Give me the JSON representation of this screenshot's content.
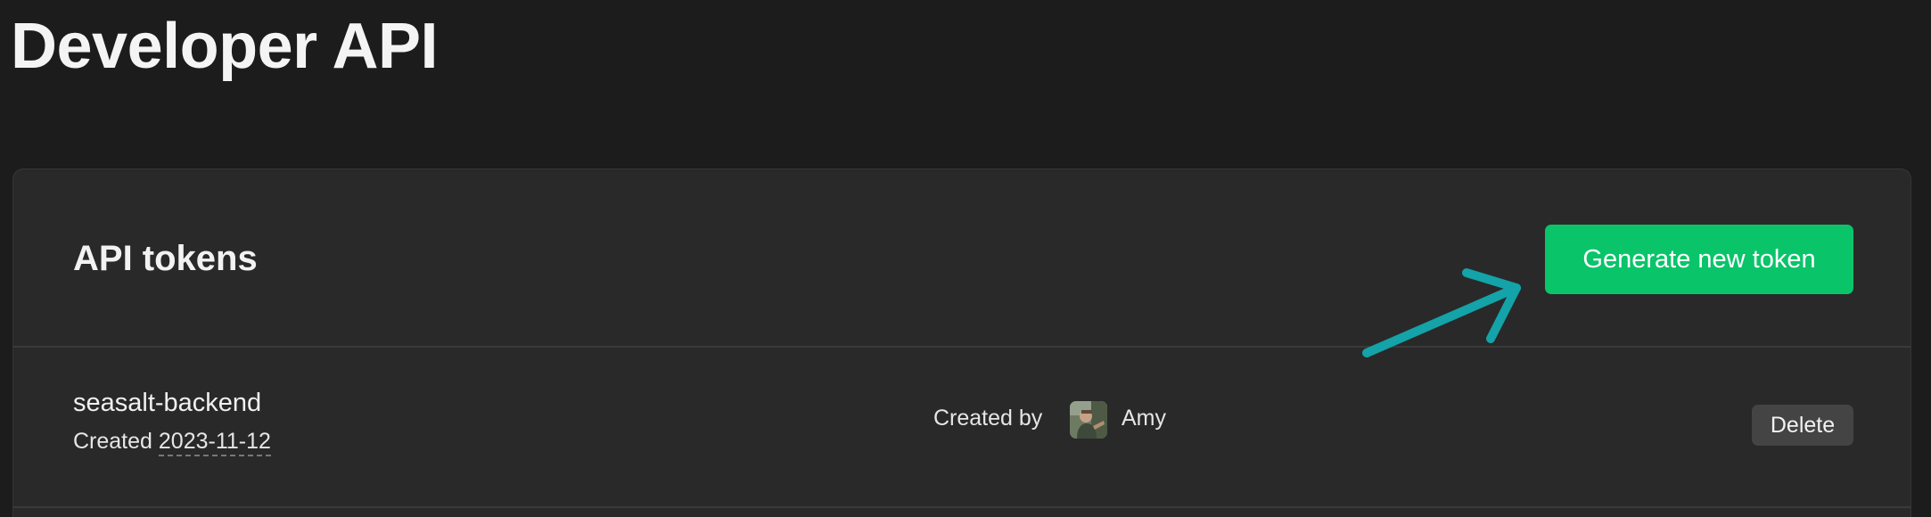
{
  "page": {
    "title": "Developer API"
  },
  "tokens_section": {
    "title": "API tokens",
    "generate_button_label": "Generate new token",
    "generate_button_color": "#0ac46a",
    "annotation_arrow_color": "#13a3a8"
  },
  "tokens": [
    {
      "name": "seasalt-backend",
      "created_prefix": "Created",
      "created_date": "2023-11-12",
      "created_by_label": "Created by",
      "creator_name": "Amy",
      "delete_label": "Delete"
    }
  ],
  "colors": {
    "background": "#1c1c1c",
    "card": "#292929",
    "accent_green": "#0ac46a",
    "delete_button": "#444444"
  }
}
